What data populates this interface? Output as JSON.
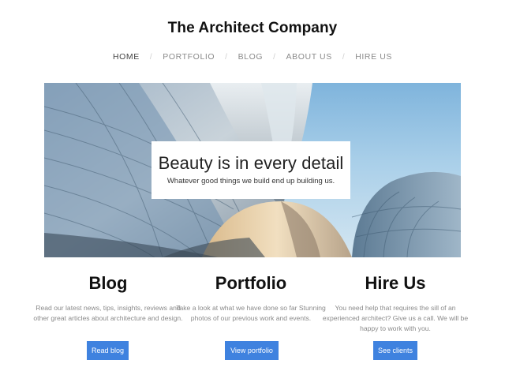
{
  "site": {
    "title": "The Architect Company"
  },
  "nav": {
    "items": [
      {
        "label": "HOME"
      },
      {
        "label": "PORTFOLIO"
      },
      {
        "label": "BLOG"
      },
      {
        "label": "ABOUT US"
      },
      {
        "label": "HIRE US"
      }
    ],
    "separator": "/"
  },
  "hero": {
    "heading": "Beauty is in every detail",
    "subheading": "Whatever good things we build end up building us."
  },
  "columns": [
    {
      "title": "Blog",
      "text": "Read our latest news, tips, insights, reviews and other great articles about architecture and design.",
      "button": "Read blog"
    },
    {
      "title": "Portfolio",
      "text": "Take a look at what we have done so far Stunning photos of our previous work and events.",
      "button": "View portfolio"
    },
    {
      "title": "Hire Us",
      "text": "You need help that requires the sill of an experienced architect? Give us a call. We will be happy to work with you.",
      "button": "See clients"
    }
  ],
  "colors": {
    "accent": "#3f82df",
    "sky": "#a9cfe9"
  }
}
